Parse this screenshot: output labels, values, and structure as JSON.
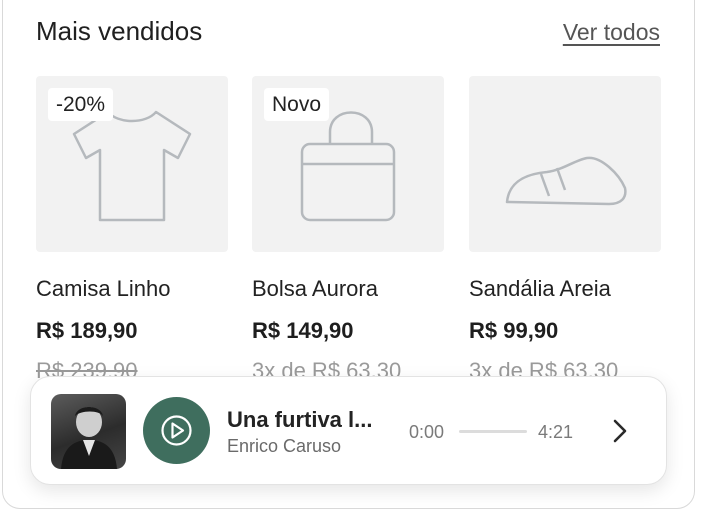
{
  "section": {
    "title": "Mais vendidos",
    "see_all": "Ver todos"
  },
  "products": [
    {
      "badge": "-20%",
      "icon": "tshirt-icon",
      "name": "Camisa Linho",
      "price": "R$ 189,90",
      "subline": "R$ 239,90",
      "subline_strike": true
    },
    {
      "badge": "Novo",
      "icon": "handbag-icon",
      "name": "Bolsa Aurora",
      "price": "R$ 149,90",
      "subline": "3x de R$ 63,30",
      "subline_strike": false
    },
    {
      "badge": "",
      "icon": "shoe-icon",
      "name": "Sandália Areia",
      "price": "R$ 99,90",
      "subline": "3x de R$ 63,30",
      "subline_strike": false
    }
  ],
  "faded_extra": "3x",
  "player": {
    "title": "Una furtiva l...",
    "artist": "Enrico Caruso",
    "time_current": "0:00",
    "time_total": "4:21",
    "progress": 0,
    "accent": "#3f6e5e"
  }
}
